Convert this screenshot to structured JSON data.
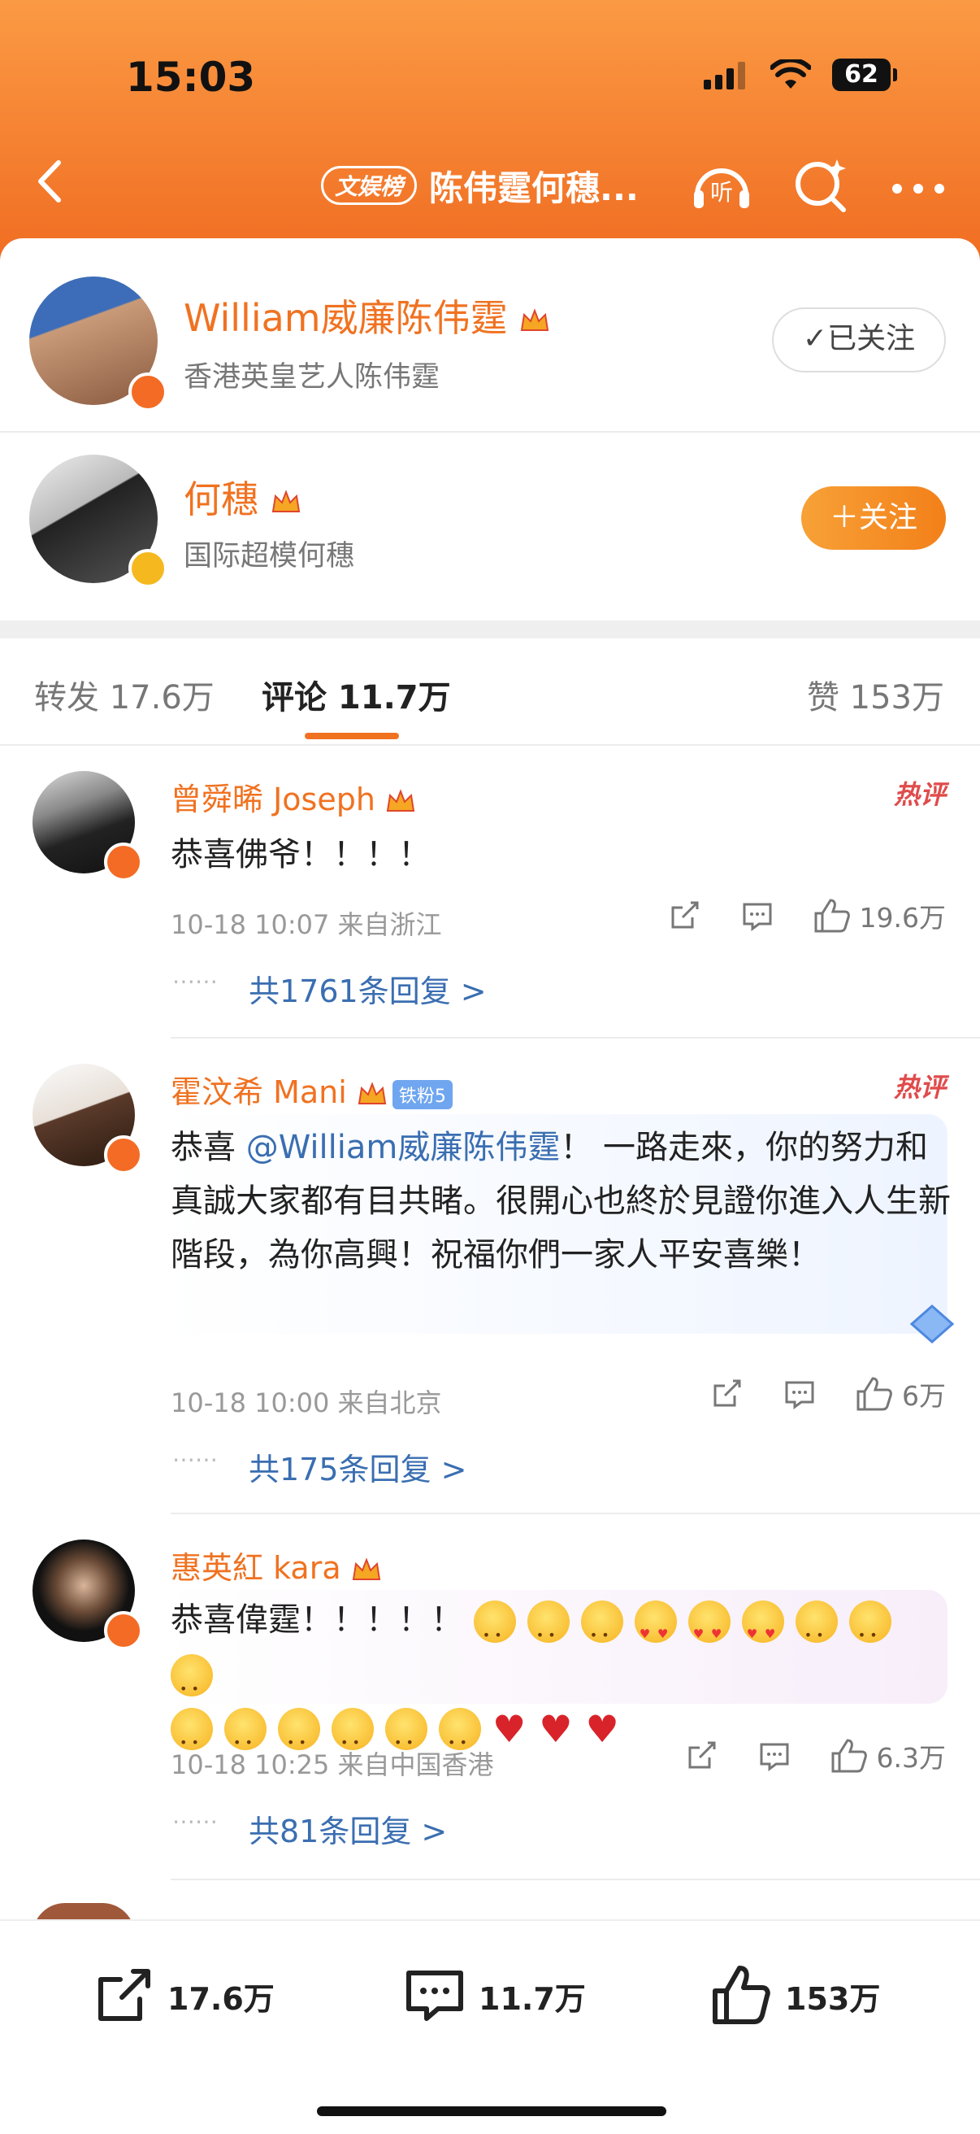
{
  "status_bar": {
    "time": "15:03",
    "battery": "62"
  },
  "nav": {
    "badge": "文娱榜",
    "title": "陈伟霆何穗...",
    "listen_label": "听"
  },
  "users": [
    {
      "name": "William威廉陈伟霆",
      "desc": "香港英皇艺人陈伟霆",
      "button": "✓已关注",
      "followed": true
    },
    {
      "name": "何穗",
      "desc": "国际超模何穗",
      "button": "＋关注",
      "followed": false
    }
  ],
  "tabs": {
    "repost": "转发 17.6万",
    "comments": "评论 11.7万",
    "likes": "赞 153万"
  },
  "comments": [
    {
      "name": "曾舜晞 Joseph",
      "body": "恭喜佛爷！！！！",
      "meta": "10-18 10:07  来自浙江",
      "likes": "19.6万",
      "replies": "共1761条回复 >",
      "hot": "热评"
    },
    {
      "name": "霍汶希 Mani",
      "fan_badge": "铁粉5",
      "body_pre": "恭喜 ",
      "mention": "@William威廉陈伟霆",
      "body_post": "！ 一路走來，你的努力和真誠大家都有目共睹。很開心也終於見證你進入人生新階段，為你高興！祝福你們一家人平安喜樂！",
      "meta": "10-18 10:00  来自北京",
      "likes": "6万",
      "replies": "共175条回复 >",
      "hot": "热评"
    },
    {
      "name": "惠英紅 kara",
      "body": "恭喜偉霆！！！！！",
      "meta": "10-18 10:25  来自中国香港",
      "likes": "6.3万",
      "replies": "共81条回复 >"
    }
  ],
  "bottom_bar": {
    "repost": "17.6万",
    "comments": "11.7万",
    "likes": "153万"
  },
  "colors": {
    "accent": "#f07221",
    "link": "#3a6eb1",
    "header_top": "#fb9a44",
    "header_bottom": "#f06d22"
  }
}
